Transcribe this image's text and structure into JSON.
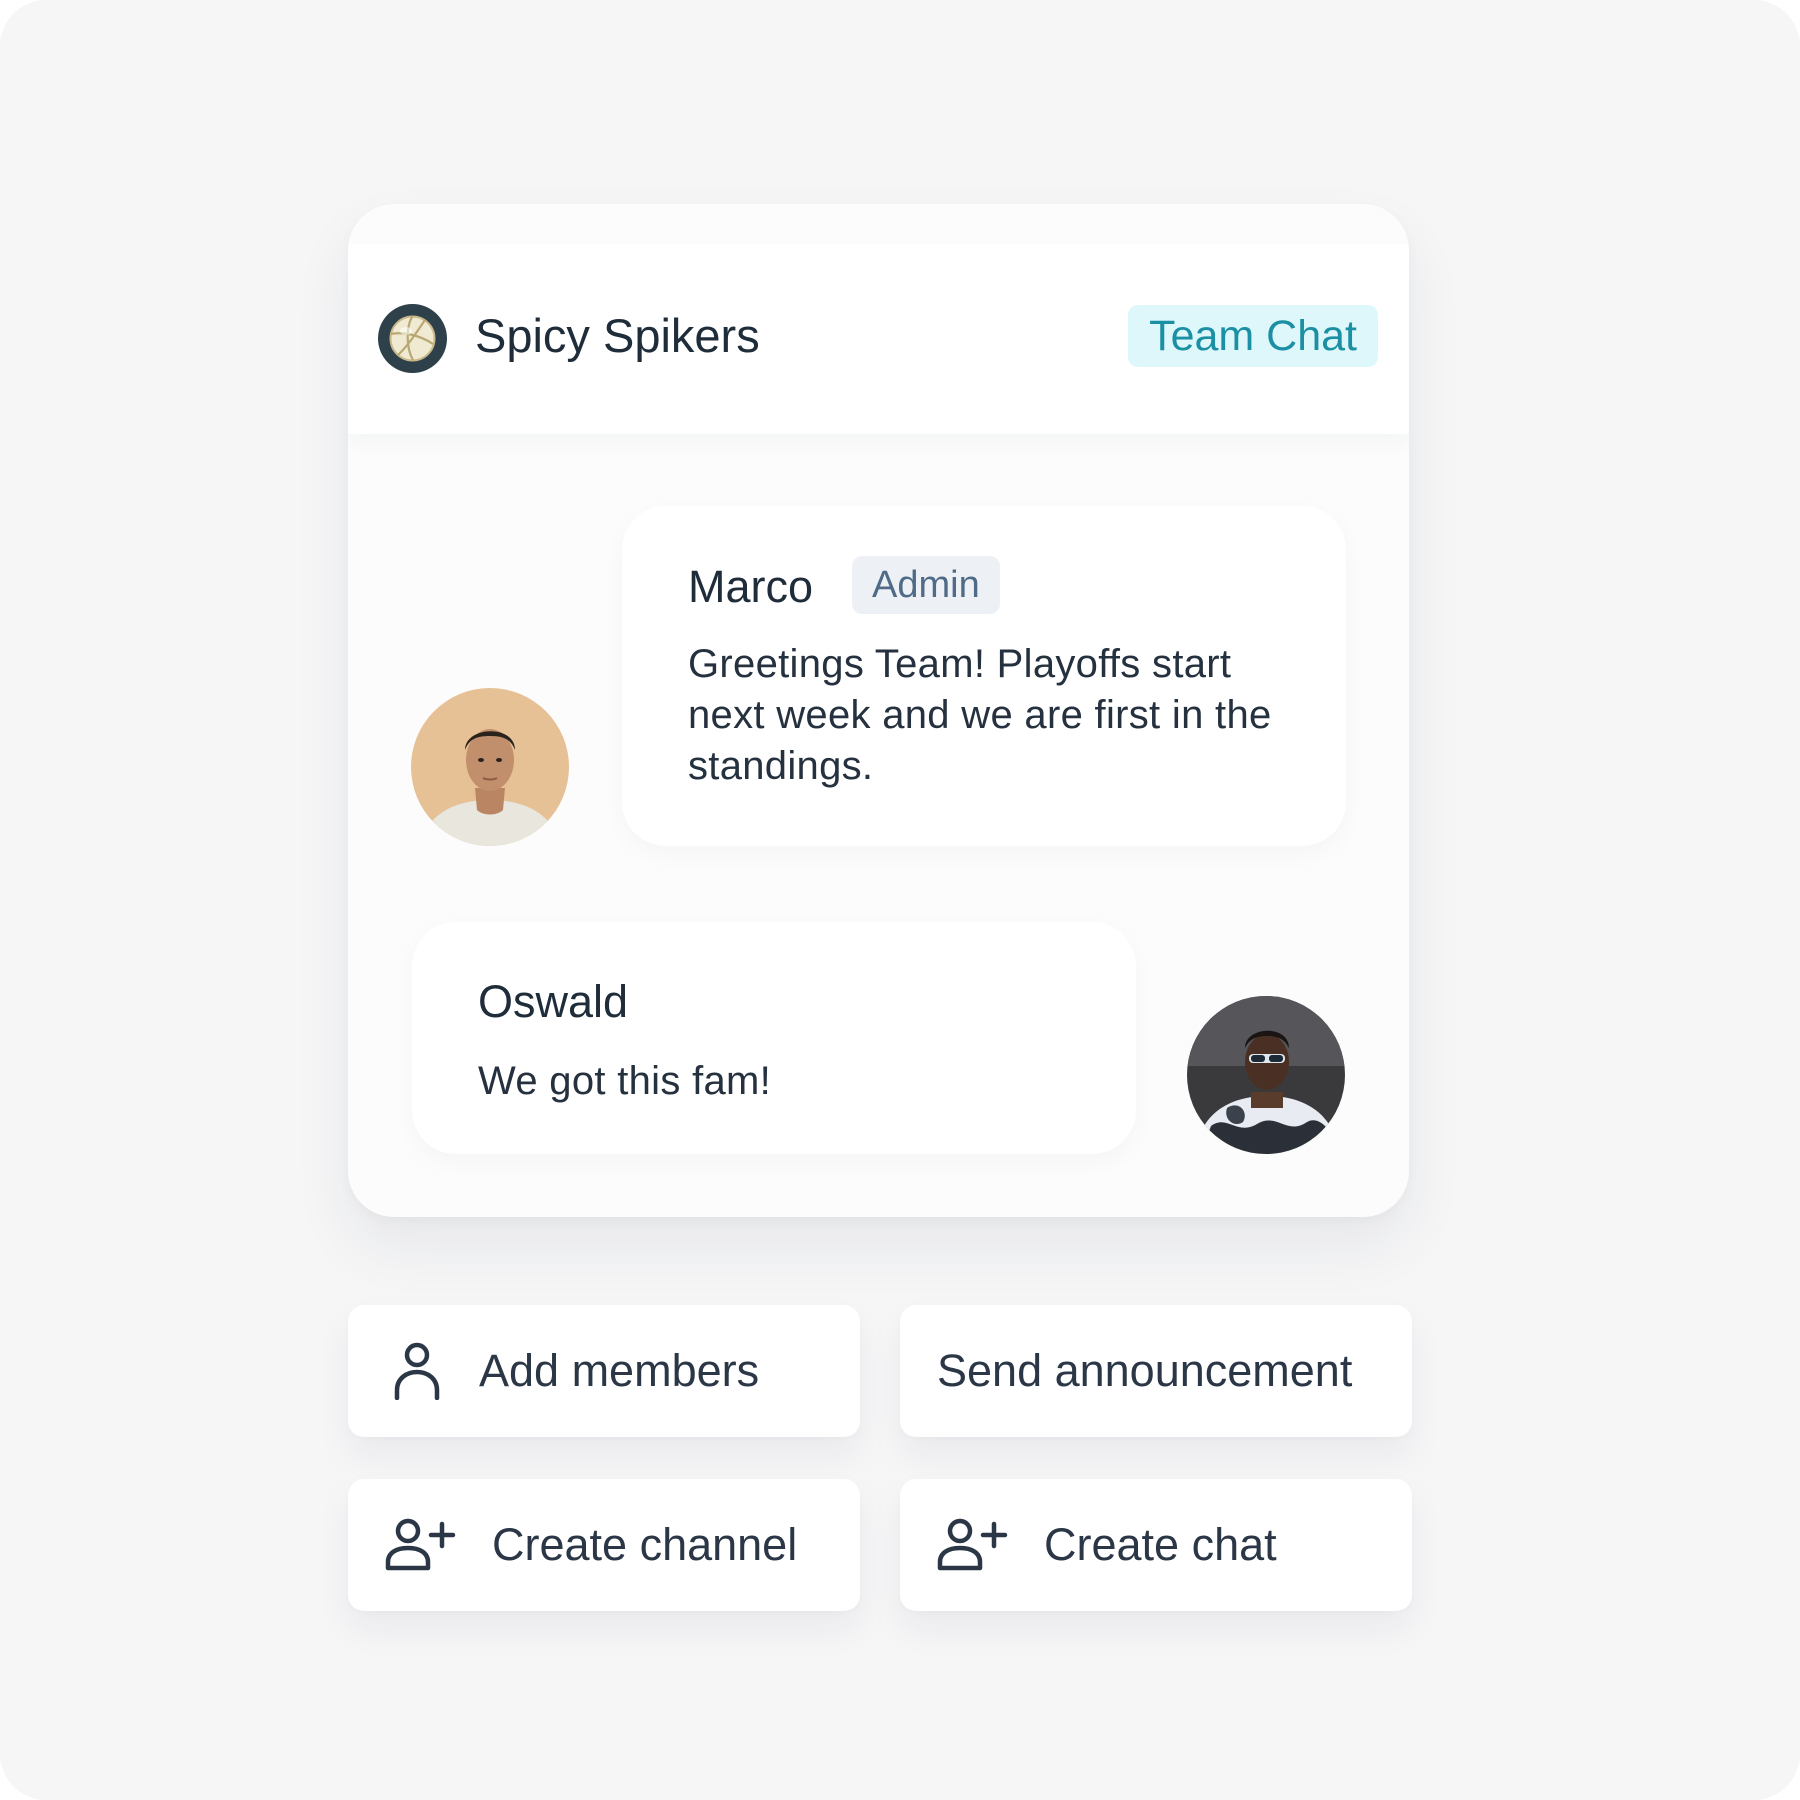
{
  "header": {
    "team_name": "Spicy Spikers",
    "badge": "Team Chat",
    "logo_icon": "volleyball-icon"
  },
  "messages": [
    {
      "author": "Marco",
      "role": "Admin",
      "text": "Greetings Team! Playoffs start next week and we are first in the standings.",
      "avatar": "avatar-photo"
    },
    {
      "author": "Oswald",
      "text": "We got this fam!",
      "avatar": "avatar-photo"
    }
  ],
  "actions": {
    "add_members": "Add members",
    "send_announcement": "Send announcement",
    "create_channel": "Create channel",
    "create_chat": "Create chat"
  },
  "colors": {
    "background": "#f6f6f7",
    "card": "#fcfcfc",
    "text": "#1f2c3a",
    "badge_bg": "#def7fb",
    "badge_text": "#1b8fa4",
    "admin_bg": "#edf1f5",
    "admin_text": "#4f6b88"
  }
}
